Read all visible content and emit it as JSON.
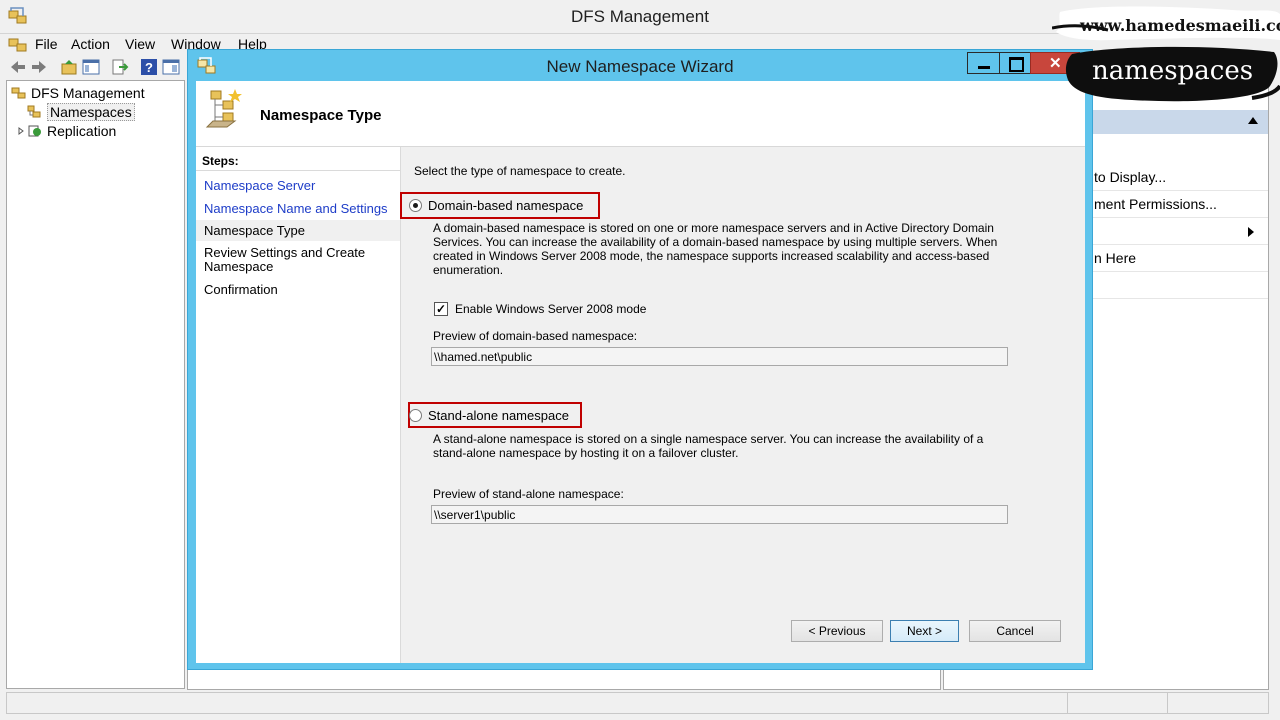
{
  "main_window": {
    "title": "DFS Management",
    "menu": [
      "File",
      "Action",
      "View",
      "Window",
      "Help"
    ]
  },
  "tree": {
    "root": "DFS Management",
    "items": [
      "Namespaces",
      "Replication"
    ]
  },
  "actions": {
    "items": [
      "to Display...",
      "ment Permissions...",
      "n Here"
    ]
  },
  "wizard": {
    "title": "New Namespace Wizard",
    "header": "Namespace Type",
    "steps_title": "Steps:",
    "steps": [
      "Namespace Server",
      "Namespace Name and Settings",
      "Namespace Type",
      "Review Settings and Create Namespace",
      "Confirmation"
    ],
    "current_step": "Namespace Type",
    "lead": "Select the type of namespace to create.",
    "domain_option": {
      "label": "Domain-based namespace",
      "selected": true,
      "description": "A domain-based namespace is stored on one or more namespace servers and in Active Directory Domain Services. You can increase the availability of a domain-based namespace by using multiple servers. When created in Windows Server 2008 mode, the namespace supports increased scalability and access-based enumeration.",
      "checkbox_label": "Enable Windows Server 2008 mode",
      "checkbox_checked": true,
      "preview_label": "Preview of domain-based namespace:",
      "preview_value": "\\\\hamed.net\\public"
    },
    "standalone_option": {
      "label": "Stand-alone namespace",
      "selected": false,
      "description": "A stand-alone namespace is stored on a single namespace server. You can increase the availability of a stand-alone namespace by hosting it on a failover cluster.",
      "preview_label": "Preview of stand-alone namespace:",
      "preview_value": "\\\\server1\\public"
    },
    "buttons": {
      "previous": "< Previous",
      "next": "Next >",
      "cancel": "Cancel"
    }
  },
  "watermark": {
    "url": "www.hamedesmaeili.com",
    "tag": "namespaces"
  },
  "colors": {
    "wizard_frame": "#5fc4ec",
    "highlight": "#c00000",
    "link": "#1e3dc8",
    "close_button": "#c8463c"
  }
}
